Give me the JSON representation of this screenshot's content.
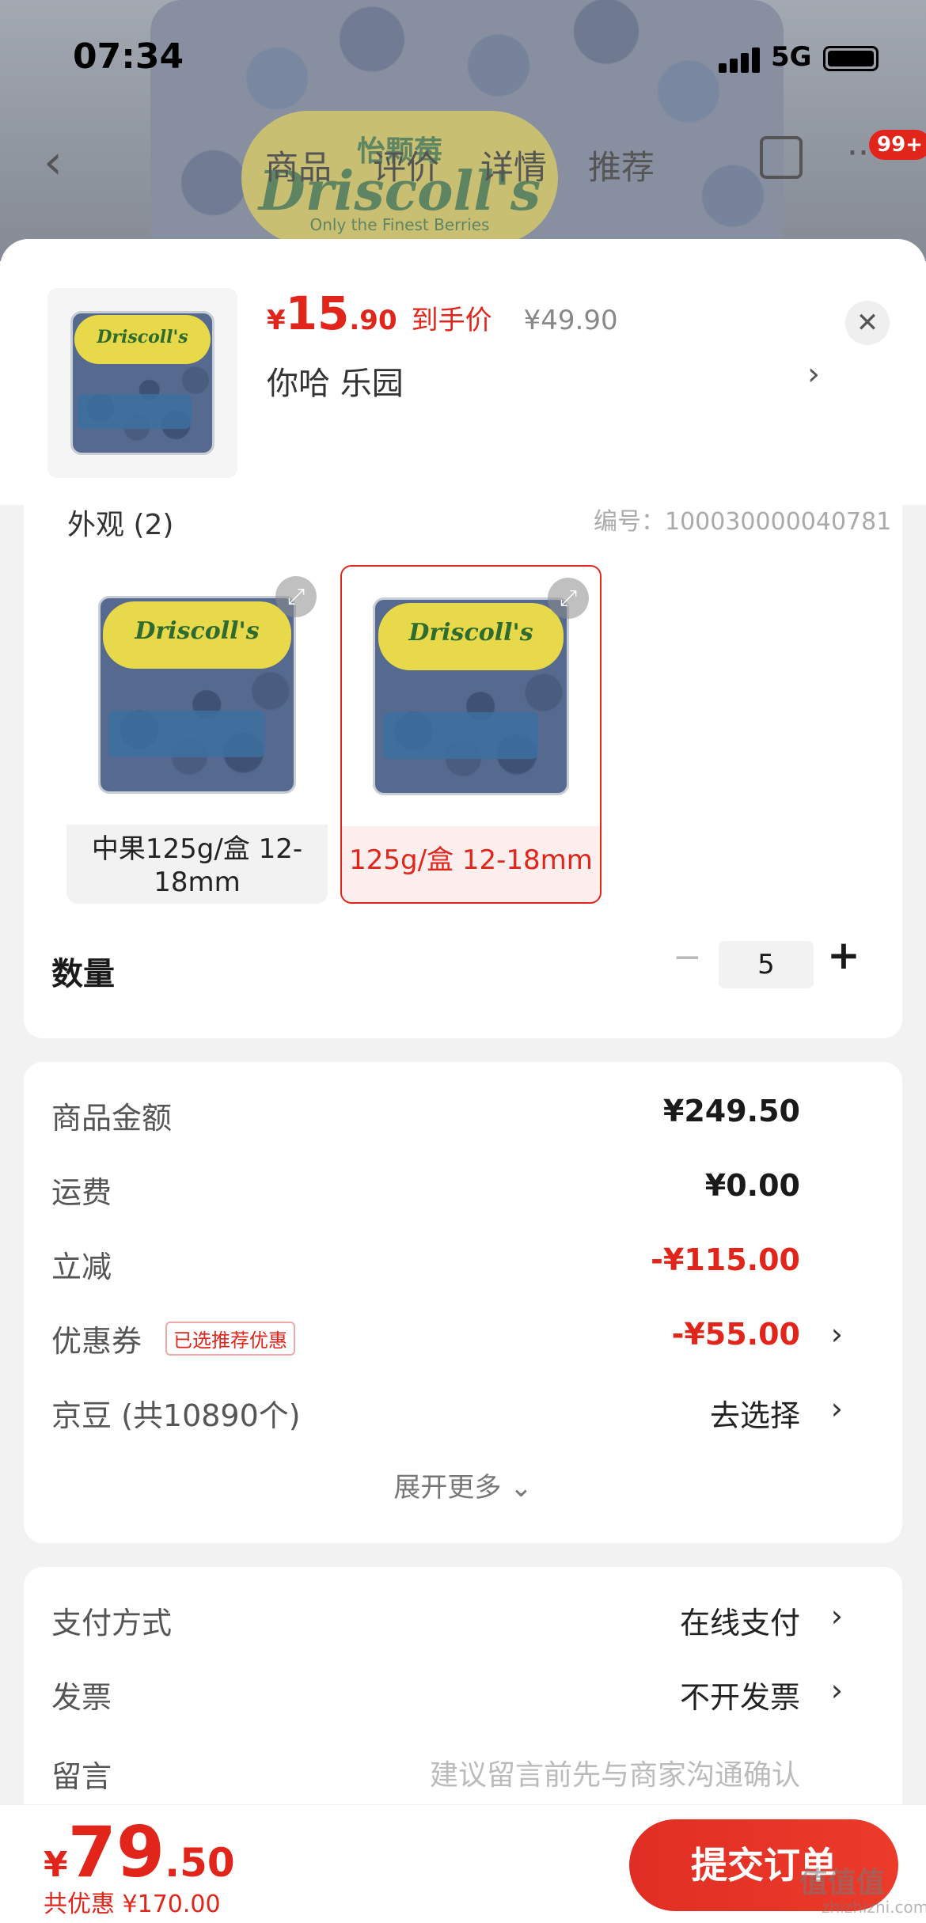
{
  "status_bar": {
    "time": "07:34",
    "network": "5G"
  },
  "background_page": {
    "tabs": [
      "商品",
      "评价",
      "详情",
      "推荐"
    ],
    "badge": "99+",
    "logo_top": "怡颗莓",
    "logo_main": "Driscoll's",
    "logo_sub": "Only the Finest Berries"
  },
  "header": {
    "price_currency": "¥",
    "price_int": "15",
    "price_dec": ".90",
    "price_label": "到手价",
    "original_price": "¥49.90",
    "selection_text": "你哈  乐园",
    "chevron": "›",
    "close": "✕"
  },
  "spec": {
    "peek_label": "外观 (2)",
    "peek_right": "编号：100030000040781",
    "options": [
      {
        "label": "中果125g/盒 12-18mm",
        "selected": false
      },
      {
        "label": "125g/盒 12-18mm",
        "selected": true
      }
    ],
    "zoom_icon": "⤢"
  },
  "quantity": {
    "label": "数量",
    "minus": "−",
    "value": "5",
    "plus": "+"
  },
  "price_details": {
    "rows": [
      {
        "label": "商品金额",
        "value": "¥249.50"
      },
      {
        "label": "运费",
        "value": "¥0.00"
      },
      {
        "label": "立减",
        "value": "-¥115.00"
      },
      {
        "label": "优惠券",
        "tag": "已选推荐优惠",
        "value": "-¥55.00"
      },
      {
        "label": "京豆 (共10890个)",
        "value": "去选择"
      }
    ],
    "expand": "展开更多 ⌄"
  },
  "payment": {
    "rows": [
      {
        "label": "支付方式",
        "value": "在线支付"
      },
      {
        "label": "发票",
        "value": "不开发票"
      },
      {
        "label": "留言",
        "placeholder": "建议留言前先与商家沟通确认"
      }
    ]
  },
  "bottom": {
    "currency": "¥",
    "total_int": "79",
    "total_dec": ".50",
    "discount": "共优惠 ¥170.00",
    "submit": "提交订单"
  },
  "watermark": {
    "main": "值值值",
    "sub": "zhizhizhi.com"
  },
  "colors": {
    "accent": "#e1251b",
    "background": "#f2f2f2"
  }
}
